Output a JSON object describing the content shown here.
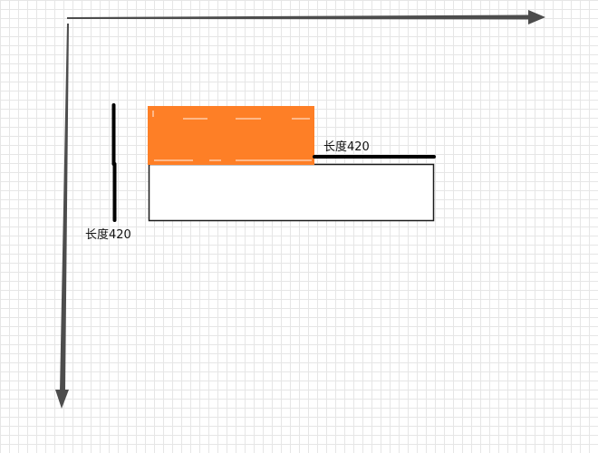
{
  "labels": {
    "horizontal_length": "长度420",
    "vertical_length": "长度420"
  },
  "colors": {
    "grid_line": "#e6e6e6",
    "axis_arrow": "#4d4d4d",
    "orange_box": "#fe7f26",
    "outline_box_stroke": "#1a1a1a",
    "length_bar": "#000000",
    "dash_marks": "#ffffff"
  }
}
